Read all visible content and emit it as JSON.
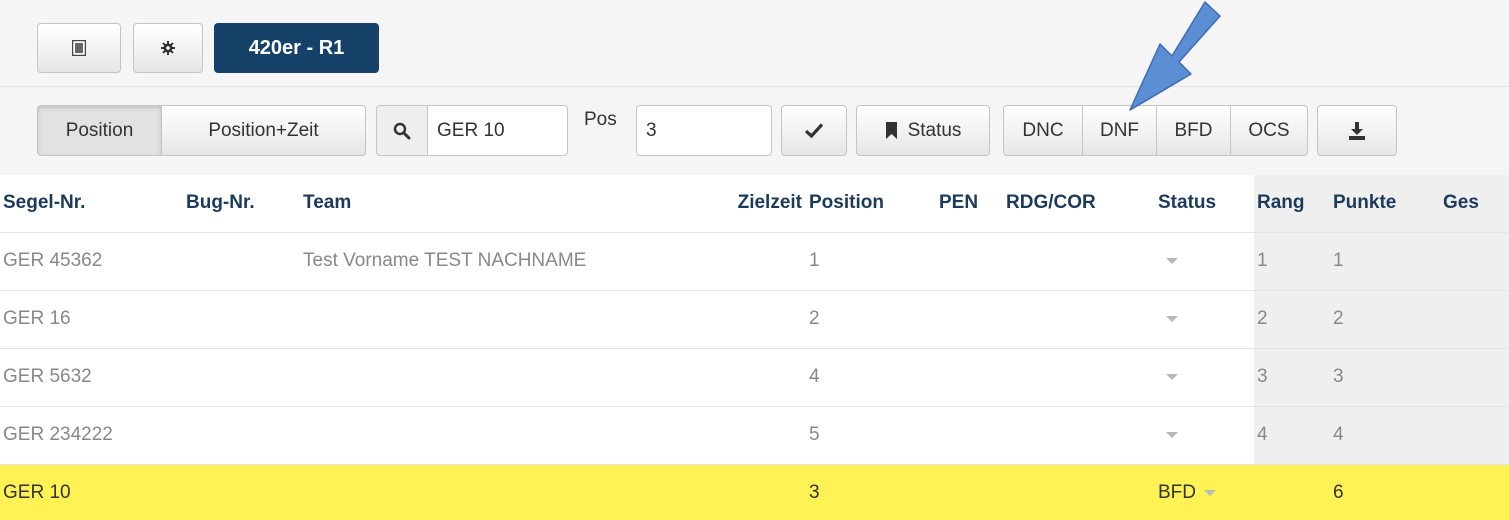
{
  "toolbar": {
    "race_name": "420er - R1"
  },
  "filterbar": {
    "view_position": "Position",
    "view_position_zeit": "Position+Zeit",
    "search_value": "GER 10",
    "pos_label": "Pos",
    "pos_value": "3",
    "status_label": "Status",
    "status_buttons": [
      "DNC",
      "DNF",
      "BFD",
      "OCS"
    ]
  },
  "table": {
    "headers": {
      "segel": "Segel-Nr.",
      "bug": "Bug-Nr.",
      "team": "Team",
      "zielzeit": "Zielzeit",
      "position": "Position",
      "pen": "PEN",
      "rdg": "RDG/COR",
      "status": "Status",
      "rang": "Rang",
      "punkte": "Punkte",
      "ges": "Ges"
    },
    "rows": [
      {
        "segel": "GER 45362",
        "bug": "",
        "team": "Test Vorname TEST NACHNAME",
        "zielzeit": "",
        "position": "1",
        "pen": "",
        "rdg": "",
        "status": "",
        "rang": "1",
        "punkte": "1"
      },
      {
        "segel": "GER 16",
        "bug": "",
        "team": "",
        "zielzeit": "",
        "position": "2",
        "pen": "",
        "rdg": "",
        "status": "",
        "rang": "2",
        "punkte": "2"
      },
      {
        "segel": "GER 5632",
        "bug": "",
        "team": "",
        "zielzeit": "",
        "position": "4",
        "pen": "",
        "rdg": "",
        "status": "",
        "rang": "3",
        "punkte": "3"
      },
      {
        "segel": "GER 234222",
        "bug": "",
        "team": "",
        "zielzeit": "",
        "position": "5",
        "pen": "",
        "rdg": "",
        "status": "",
        "rang": "4",
        "punkte": "4"
      },
      {
        "segel": "GER 10",
        "bug": "",
        "team": "",
        "zielzeit": "",
        "position": "3",
        "pen": "",
        "rdg": "",
        "status": "BFD",
        "rang": "",
        "punkte": "6"
      }
    ]
  },
  "colors": {
    "badge": "#16426a",
    "header_text": "#1c3a5a",
    "highlight_row": "#fef254",
    "annotation_arrow": "#5b8ed3"
  },
  "icons": {
    "sidebar_toggle": "columns-icon",
    "settings": "gear-icon",
    "search": "search-icon",
    "confirm": "checkmark-icon",
    "status": "bookmark-icon",
    "download": "download-icon",
    "annotation": "arrow-pointer-icon"
  }
}
